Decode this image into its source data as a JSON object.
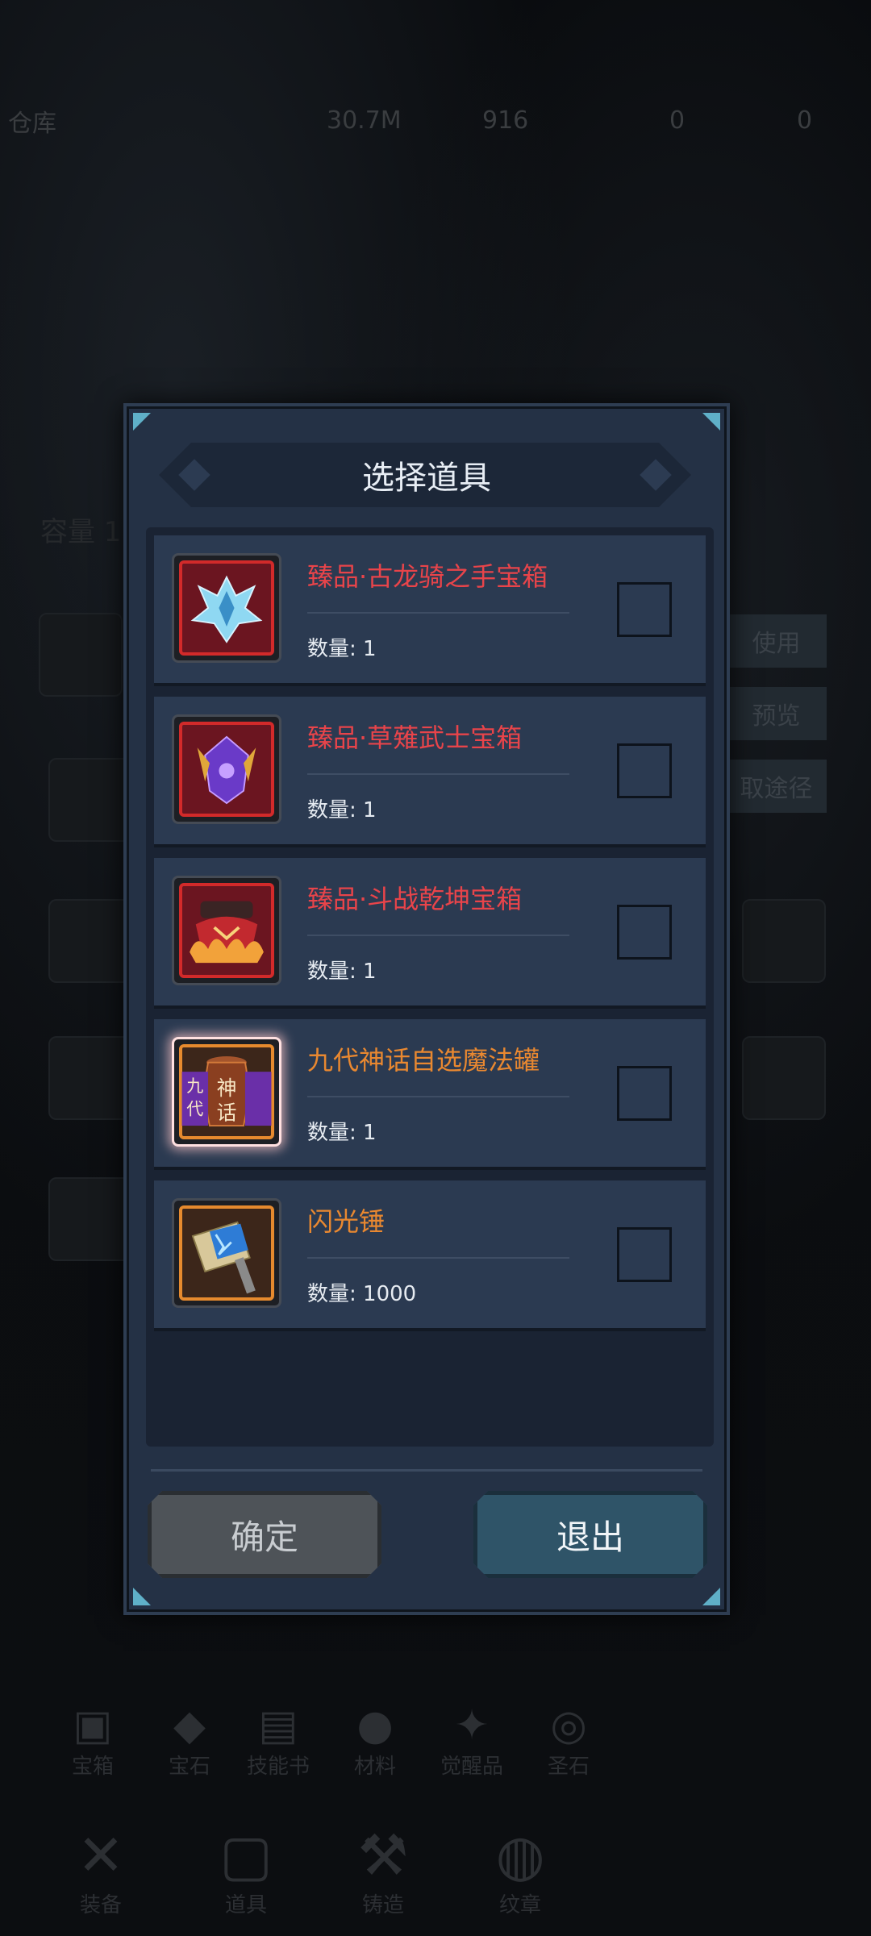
{
  "background": {
    "warehouse_label": "仓库",
    "stats": [
      "30.7M",
      "916",
      "0",
      "0"
    ],
    "left_label": "容量 1",
    "right_buttons": [
      "使用",
      "预览",
      "取途径"
    ],
    "tabs": [
      "宝箱",
      "宝石",
      "技能书",
      "材料",
      "觉醒品",
      "圣石"
    ],
    "nav": [
      "装备",
      "道具",
      "铸造",
      "纹章"
    ]
  },
  "dialog": {
    "title": "选择道具",
    "items": [
      {
        "name": "臻品·古龙骑之手宝箱",
        "quantity": "数量: 1",
        "rarity": "red",
        "icon": "dragon-knight-icon"
      },
      {
        "name": "臻品·草薙武士宝箱",
        "quantity": "数量: 1",
        "rarity": "red",
        "icon": "samurai-icon"
      },
      {
        "name": "臻品·斗战乾坤宝箱",
        "quantity": "数量: 1",
        "rarity": "red",
        "icon": "battle-crown-icon"
      },
      {
        "name": "九代神话自选魔法罐",
        "quantity": "数量: 1",
        "rarity": "orange",
        "icon": "magic-jar-icon",
        "icon_text": [
          "九",
          "代",
          "神",
          "话"
        ]
      },
      {
        "name": "闪光锤",
        "quantity": "数量: 1000",
        "rarity": "orange",
        "icon": "flash-hammer-icon"
      }
    ],
    "confirm_label": "确定",
    "exit_label": "退出"
  },
  "colors": {
    "rarity_red": "#e8444a",
    "rarity_orange": "#e98830",
    "dialog_bg": "#243145"
  }
}
